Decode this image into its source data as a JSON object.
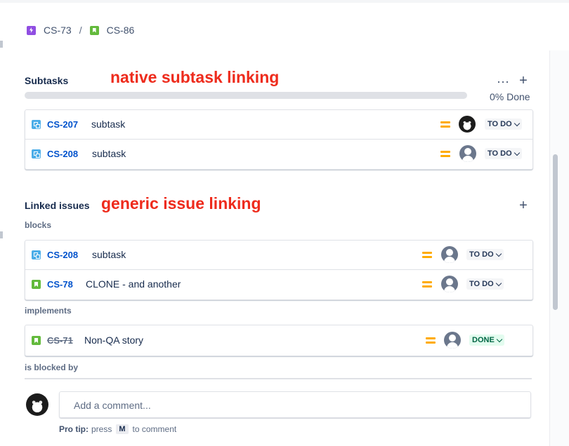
{
  "breadcrumb": {
    "parent_key": "CS-73",
    "separator": "/",
    "current_key": "CS-86"
  },
  "subtasks": {
    "title": "Subtasks",
    "annotation": "native subtask linking",
    "more_icon": "more-icon",
    "add_icon": "plus-icon",
    "progress_text": "0% Done",
    "progress_value": 0,
    "items": [
      {
        "key": "CS-207",
        "summary": "subtask",
        "status": "TO DO",
        "avatar": "cat"
      },
      {
        "key": "CS-208",
        "summary": "subtask",
        "status": "TO DO",
        "avatar": "default"
      }
    ]
  },
  "linked": {
    "title": "Linked issues",
    "annotation": "generic issue linking",
    "add_icon": "plus-icon",
    "groups": [
      {
        "label": "blocks",
        "items": [
          {
            "key": "CS-208",
            "summary": "subtask",
            "status": "TO DO",
            "type": "subtask"
          },
          {
            "key": "CS-78",
            "summary": "CLONE - and another",
            "status": "TO DO",
            "type": "story"
          }
        ]
      },
      {
        "label": "implements",
        "items": [
          {
            "key": "CS-71",
            "summary": "Non-QA story",
            "status": "DONE",
            "type": "story",
            "resolved": true
          }
        ]
      },
      {
        "label": "is blocked by",
        "items": []
      }
    ]
  },
  "comment": {
    "placeholder": "Add a comment...",
    "protip_label": "Pro tip:",
    "protip_pre": "press",
    "protip_key": "M",
    "protip_post": "to comment"
  },
  "colors": {
    "annotation": "#ee2b1c",
    "link": "#0052cc",
    "priority_medium": "#ffab00",
    "done_bg": "#e3fcef",
    "done_text": "#006644"
  }
}
